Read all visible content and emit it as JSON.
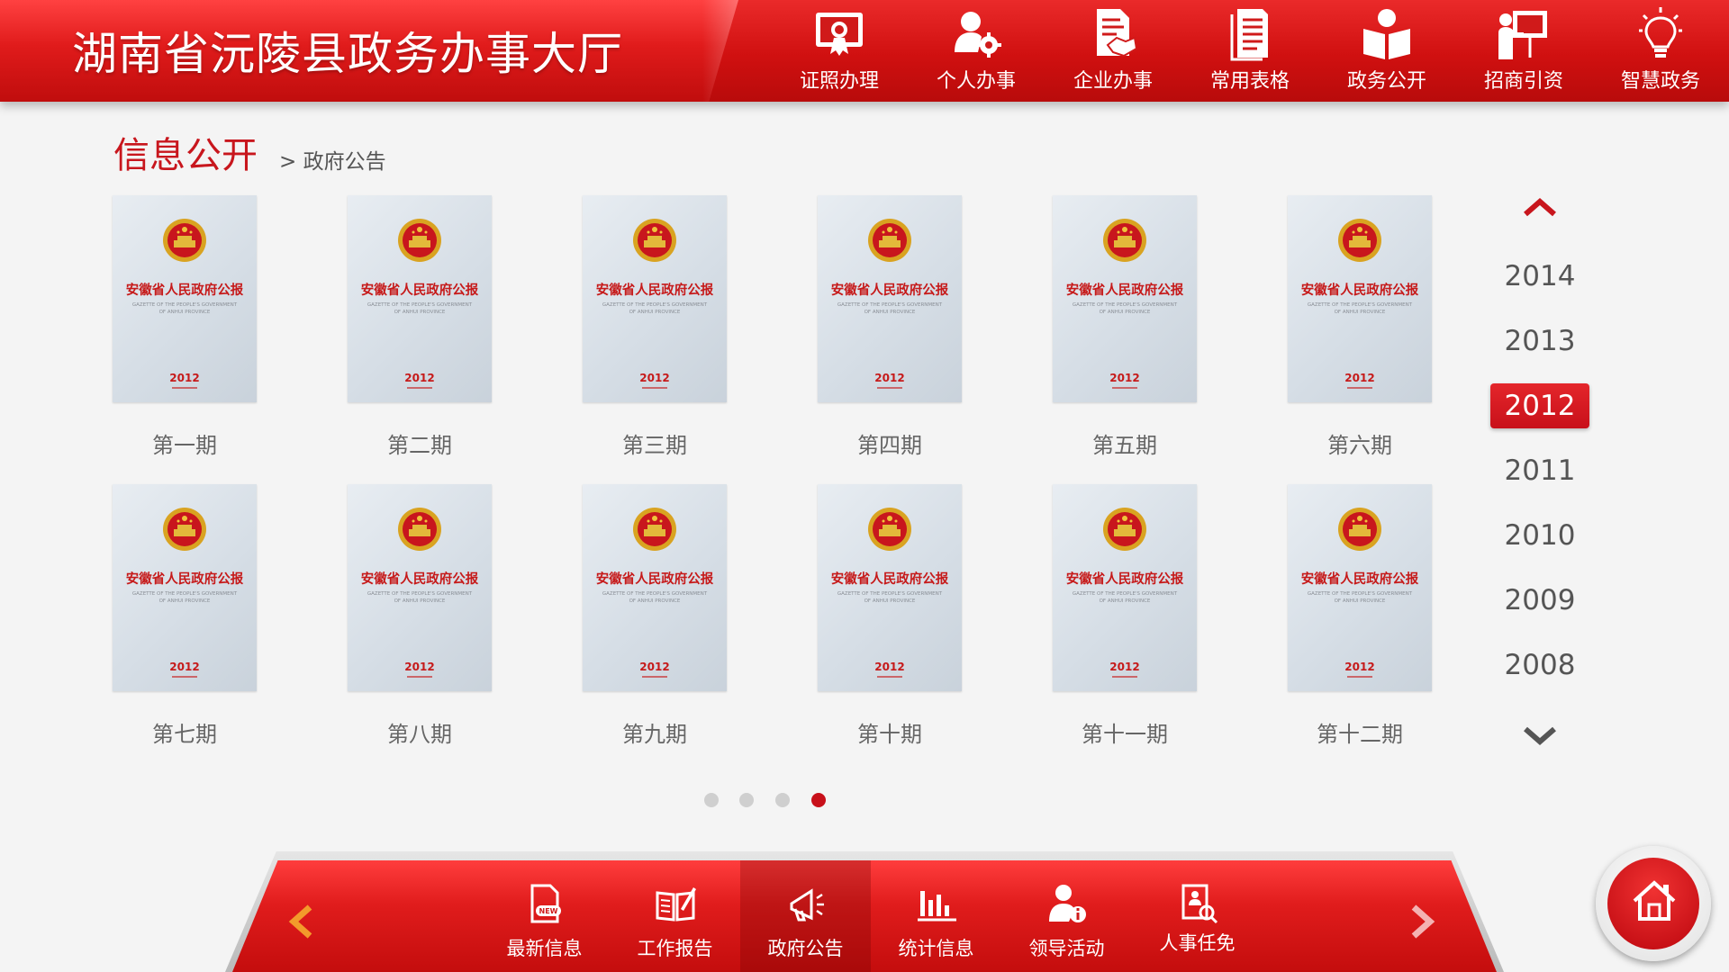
{
  "header": {
    "title": "湖南省沅陵县政务办事大厅",
    "nav": [
      {
        "label": "证照办理",
        "icon": "certificate-icon"
      },
      {
        "label": "个人办事",
        "icon": "person-gear-icon"
      },
      {
        "label": "企业办事",
        "icon": "handshake-document-icon"
      },
      {
        "label": "常用表格",
        "icon": "form-document-icon"
      },
      {
        "label": "政务公开",
        "icon": "open-book-person-icon"
      },
      {
        "label": "招商引资",
        "icon": "presentation-board-icon"
      },
      {
        "label": "智慧政务",
        "icon": "lightbulb-icon"
      }
    ]
  },
  "section": {
    "title": "信息公开",
    "breadcrumb": "> 政府公告"
  },
  "cover": {
    "title": "安徽省人民政府公报",
    "subtitle": "GAZETTE OF THE PEOPLE'S GOVERNMENT OF ANHUI PROVINCE",
    "year": "2012"
  },
  "issues": [
    {
      "label": "第一期"
    },
    {
      "label": "第二期"
    },
    {
      "label": "第三期"
    },
    {
      "label": "第四期"
    },
    {
      "label": "第五期"
    },
    {
      "label": "第六期"
    },
    {
      "label": "第七期"
    },
    {
      "label": "第八期"
    },
    {
      "label": "第九期"
    },
    {
      "label": "第十期"
    },
    {
      "label": "第十一期"
    },
    {
      "label": "第十二期"
    }
  ],
  "years": {
    "items": [
      "2014",
      "2013",
      "2012",
      "2011",
      "2010",
      "2009",
      "2008"
    ],
    "selected": "2012"
  },
  "pager": {
    "count": 4,
    "current": 4
  },
  "bottom_nav": {
    "items": [
      {
        "label": "最新信息",
        "icon": "new-document-icon"
      },
      {
        "label": "工作报告",
        "icon": "open-book-pen-icon"
      },
      {
        "label": "政府公告",
        "icon": "megaphone-icon"
      },
      {
        "label": "统计信息",
        "icon": "bar-chart-icon"
      },
      {
        "label": "领导活动",
        "icon": "person-info-icon"
      },
      {
        "label": "人事任免",
        "icon": "document-search-icon"
      }
    ],
    "active": "政府公告"
  },
  "colors": {
    "brand_red": "#c8161d",
    "arrow_orange": "#f39a2b"
  }
}
